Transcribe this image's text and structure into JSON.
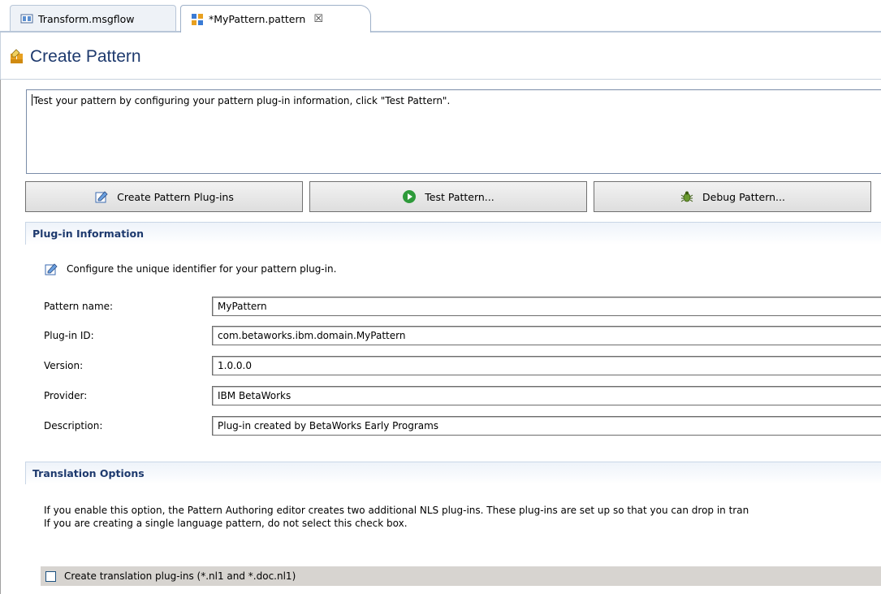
{
  "tabs": [
    {
      "label": "Transform.msgflow",
      "icon": "msgflow-icon",
      "active": false
    },
    {
      "label": "*MyPattern.pattern",
      "icon": "pattern-icon",
      "active": true,
      "close_glyph": "☒"
    }
  ],
  "form": {
    "title": "Create Pattern",
    "icon": "create-pattern-icon"
  },
  "message": "Test your pattern by configuring your pattern plug-in information, click \"Test Pattern\".",
  "buttons": {
    "create_plugins": "Create Pattern Plug-ins",
    "test_pattern": "Test Pattern...",
    "debug_pattern": "Debug Pattern..."
  },
  "plugin_info": {
    "heading": "Plug-in Information",
    "hint": "Configure the unique identifier for your pattern plug-in.",
    "fields": {
      "pattern_name": {
        "label": "Pattern name:",
        "value": "MyPattern"
      },
      "plugin_id": {
        "label": "Plug-in ID:",
        "value": "com.betaworks.ibm.domain.MyPattern"
      },
      "version": {
        "label": "Version:",
        "value": "1.0.0.0"
      },
      "provider": {
        "label": "Provider:",
        "value": "IBM BetaWorks"
      },
      "description": {
        "label": "Description:",
        "value": "Plug-in created by BetaWorks Early Programs"
      }
    }
  },
  "translation": {
    "heading": "Translation Options",
    "line1": "If you enable this option, the Pattern Authoring editor creates two additional NLS plug-ins. These plug-ins are set up so that you can drop in tran",
    "line2": "If you are creating a single language pattern, do not select this check box.",
    "checkbox_label": "Create translation plug-ins (*.nl1 and *.doc.nl1)",
    "checked": false
  },
  "colors": {
    "title": "#1e3a6e",
    "section_heading": "#1e3a6e",
    "test_icon": "#2e9a3a"
  }
}
